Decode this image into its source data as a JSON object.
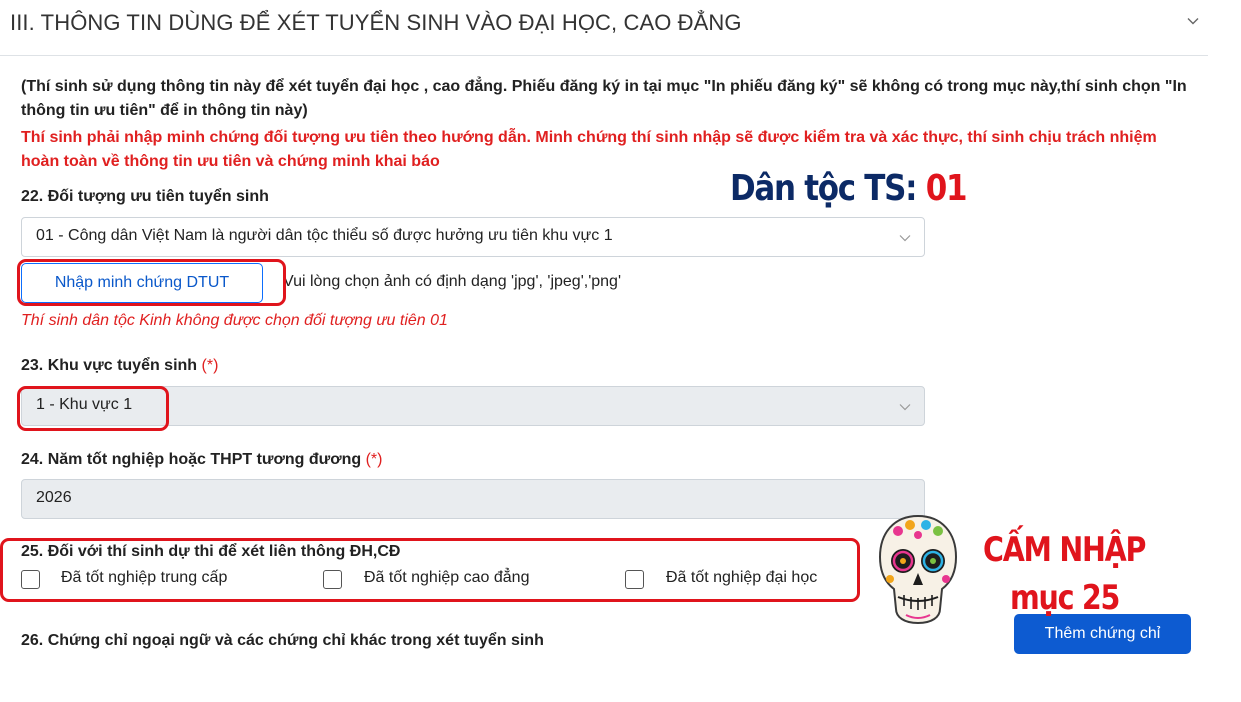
{
  "section": {
    "title": "III. THÔNG TIN DÙNG ĐỂ XÉT TUYỂN SINH VÀO ĐẠI HỌC, CAO ĐẲNG"
  },
  "notes": {
    "info": "(Thí sinh sử dụng thông tin này để xét tuyển đại học , cao đẳng. Phiếu đăng ký in tại mục \"In phiếu đăng ký\" sẽ không có trong mục này,thí sinh chọn \"In thông tin ưu tiên\" để in thông tin này)",
    "warning": "Thí sinh phải nhập minh chứng đối tượng ưu tiên theo hướng dẫn. Minh chứng thí sinh nhập sẽ được kiểm tra và xác thực, thí sinh chịu trách nhiệm hoàn toàn về thông tin ưu tiên và chứng minh khai báo"
  },
  "field22": {
    "label": "22. Đối tượng ưu tiên tuyển sinh",
    "selected": "01 - Công dân Việt Nam là người dân tộc thiểu số được hưởng ưu tiên khu vực 1",
    "evidence_button": "Nhập minh chứng DTUT",
    "file_hint": "Vui lòng chọn ảnh có định dạng 'jpg', 'jpeg','png'",
    "warning": "Thí sinh dân tộc Kinh không được chọn đối tượng ưu tiên 01"
  },
  "field23": {
    "label": "23. Khu vực tuyển sinh",
    "required_mark": "(*)",
    "selected": "1 - Khu vực 1"
  },
  "field24": {
    "label": "24. Năm tốt nghiệp hoặc THPT tương đương",
    "required_mark": "(*)",
    "value": "2026"
  },
  "field25": {
    "label": "25. Đối với thí sinh dự thi để xét liên thông ĐH,CĐ",
    "options": [
      {
        "label": "Đã tốt nghiệp trung cấp",
        "checked": false
      },
      {
        "label": "Đã tốt nghiệp cao đẳng",
        "checked": false
      },
      {
        "label": "Đã tốt nghiệp đại học",
        "checked": false
      }
    ]
  },
  "field26": {
    "label": "26. Chứng chỉ ngoại ngữ và các chứng chỉ khác trong xét tuyển sinh",
    "add_button": "Thêm chứng chỉ"
  },
  "annotations": {
    "ethnicity_label": "Dân tộc TS:",
    "ethnicity_value": "01",
    "forbidden_line1": "CẤM NHẬP",
    "forbidden_line2": "mục 25",
    "skull_icon": "sugar-skull-icon"
  },
  "colors": {
    "primary": "#0d6efd",
    "danger": "#e0141c",
    "annotation_navy": "#0c2a66"
  }
}
